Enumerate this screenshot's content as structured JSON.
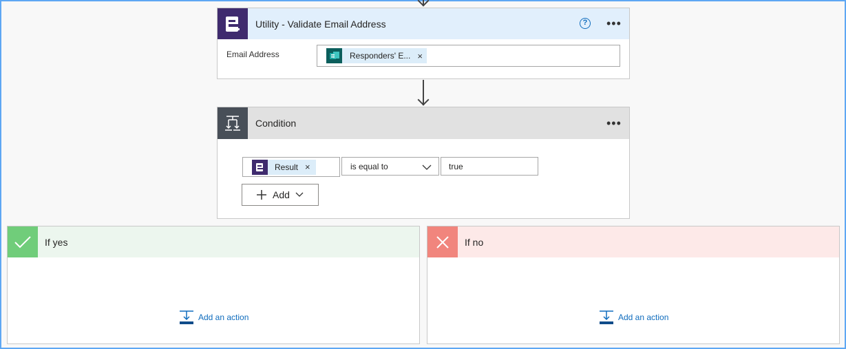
{
  "utility_card": {
    "title": "Utility - Validate Email Address",
    "help_icon": "help-circle-icon",
    "menu_icon": "more-icon",
    "param_label": "Email Address",
    "token_label": "Responders' E...",
    "token_icon": "forms-icon",
    "header_color": "#e1effc",
    "icon_color": "#3f2b6e"
  },
  "condition_card": {
    "title": "Condition",
    "menu_icon": "more-icon",
    "icon": "condition-icon",
    "header_color": "#e1e1e1",
    "icon_bg": "#484f58",
    "left_token": "Result",
    "operator": "is equal to",
    "right_value": "true",
    "add_label": "Add"
  },
  "branches": {
    "yes": {
      "label": "If yes",
      "icon": "checkmark-icon",
      "color": "#70cd7a",
      "bg": "#ecf6ee",
      "add_action": "Add an action"
    },
    "no": {
      "label": "If no",
      "icon": "close-icon",
      "color": "#f1857d",
      "bg": "#fde9e8",
      "add_action": "Add an action"
    }
  }
}
